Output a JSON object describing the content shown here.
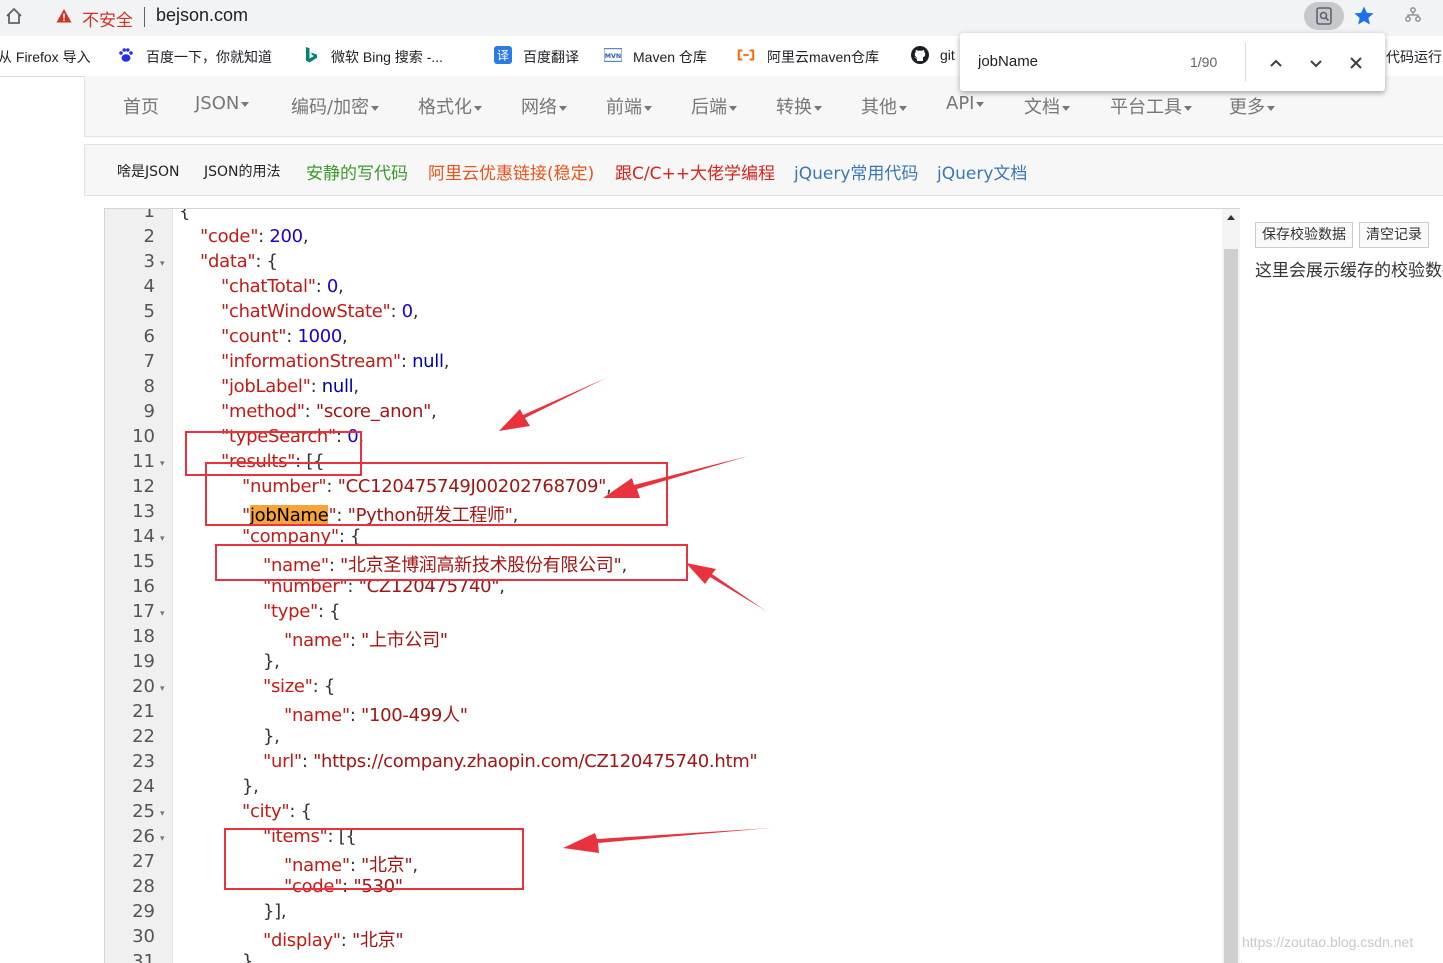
{
  "browser": {
    "security_label": "不安全",
    "url": "bejson.com",
    "icons": {
      "home": "home-icon",
      "warning": "warning-icon",
      "find": "find-icon",
      "star": "star-icon",
      "extension": "extension-icon"
    }
  },
  "bookmarks": [
    {
      "label": "从 Firefox 导入",
      "icon": ""
    },
    {
      "label": "百度一下，你就知道",
      "icon": "baidu-paw-icon"
    },
    {
      "label": "微软 Bing 搜索 -...",
      "icon": "bing-icon"
    },
    {
      "label": "百度翻译",
      "icon": "translate-icon"
    },
    {
      "label": "Maven 仓库",
      "icon": "maven-icon"
    },
    {
      "label": "阿里云maven仓库",
      "icon": "aliyun-icon"
    },
    {
      "label": "git",
      "icon": "github-icon"
    },
    {
      "label": "代码运行工",
      "icon": ""
    }
  ],
  "findbar": {
    "query": "jobName",
    "count": "1/90"
  },
  "site_nav": [
    {
      "label": "首页",
      "dropdown": false
    },
    {
      "label": "JSON",
      "dropdown": true
    },
    {
      "label": "编码/加密",
      "dropdown": true
    },
    {
      "label": "格式化",
      "dropdown": true
    },
    {
      "label": "网络",
      "dropdown": true
    },
    {
      "label": "前端",
      "dropdown": true
    },
    {
      "label": "后端",
      "dropdown": true
    },
    {
      "label": "转换",
      "dropdown": true
    },
    {
      "label": "其他",
      "dropdown": true
    },
    {
      "label": "API",
      "dropdown": true
    },
    {
      "label": "文档",
      "dropdown": true
    },
    {
      "label": "平台工具",
      "dropdown": true
    },
    {
      "label": "更多",
      "dropdown": true
    }
  ],
  "sub_nav": [
    {
      "label": "啥是JSON",
      "color": "#222222"
    },
    {
      "label": "JSON的用法",
      "color": "#222222"
    },
    {
      "label": "安静的写代码",
      "color": "#3c9a2c"
    },
    {
      "label": "阿里云优惠链接(稳定)",
      "color": "#e8541c"
    },
    {
      "label": "跟C/C++大佬学编程",
      "color": "#d9231c"
    },
    {
      "label": "jQuery常用代码",
      "color": "#3a78b5"
    },
    {
      "label": "jQuery文档",
      "color": "#3a78b5"
    }
  ],
  "editor": {
    "lines": [
      {
        "num": "1",
        "fold": false,
        "indent": 0,
        "parts": [
          [
            "p",
            "{"
          ]
        ]
      },
      {
        "num": "2",
        "fold": false,
        "indent": 1,
        "parts": [
          [
            "k",
            "\"code\""
          ],
          [
            "p",
            ": "
          ],
          [
            "n",
            "200"
          ],
          [
            "p",
            ","
          ]
        ]
      },
      {
        "num": "3",
        "fold": true,
        "indent": 1,
        "parts": [
          [
            "k",
            "\"data\""
          ],
          [
            "p",
            ": {"
          ]
        ]
      },
      {
        "num": "4",
        "fold": false,
        "indent": 2,
        "parts": [
          [
            "k",
            "\"chatTotal\""
          ],
          [
            "p",
            ": "
          ],
          [
            "n",
            "0"
          ],
          [
            "p",
            ","
          ]
        ]
      },
      {
        "num": "5",
        "fold": false,
        "indent": 2,
        "parts": [
          [
            "k",
            "\"chatWindowState\""
          ],
          [
            "p",
            ": "
          ],
          [
            "n",
            "0"
          ],
          [
            "p",
            ","
          ]
        ]
      },
      {
        "num": "6",
        "fold": false,
        "indent": 2,
        "parts": [
          [
            "k",
            "\"count\""
          ],
          [
            "p",
            ": "
          ],
          [
            "n",
            "1000"
          ],
          [
            "p",
            ","
          ]
        ]
      },
      {
        "num": "7",
        "fold": false,
        "indent": 2,
        "parts": [
          [
            "k",
            "\"informationStream\""
          ],
          [
            "p",
            ": "
          ],
          [
            "nul",
            "null"
          ],
          [
            "p",
            ","
          ]
        ]
      },
      {
        "num": "8",
        "fold": false,
        "indent": 2,
        "parts": [
          [
            "k",
            "\"jobLabel\""
          ],
          [
            "p",
            ": "
          ],
          [
            "nul",
            "null"
          ],
          [
            "p",
            ","
          ]
        ]
      },
      {
        "num": "9",
        "fold": false,
        "indent": 2,
        "parts": [
          [
            "k",
            "\"method\""
          ],
          [
            "p",
            ": "
          ],
          [
            "s",
            "\"score_anon\""
          ],
          [
            "p",
            ","
          ]
        ]
      },
      {
        "num": "10",
        "fold": false,
        "indent": 2,
        "parts": [
          [
            "k",
            "\"typeSearch\""
          ],
          [
            "p",
            ": "
          ],
          [
            "n",
            "0"
          ],
          [
            "p",
            ","
          ]
        ]
      },
      {
        "num": "11",
        "fold": true,
        "indent": 2,
        "parts": [
          [
            "k",
            "\"results\""
          ],
          [
            "p",
            ": [{"
          ]
        ]
      },
      {
        "num": "12",
        "fold": false,
        "indent": 3,
        "parts": [
          [
            "k",
            "\"number\""
          ],
          [
            "p",
            ": "
          ],
          [
            "s",
            "\"CC120475749J00202768709\""
          ],
          [
            "p",
            ","
          ]
        ]
      },
      {
        "num": "13",
        "fold": false,
        "indent": 3,
        "parts": [
          [
            "k",
            "\""
          ],
          [
            "hl",
            "jobName"
          ],
          [
            "k",
            "\""
          ],
          [
            "p",
            ": "
          ],
          [
            "s",
            "\"Python研发工程师\""
          ],
          [
            "p",
            ","
          ]
        ]
      },
      {
        "num": "14",
        "fold": true,
        "indent": 3,
        "parts": [
          [
            "k",
            "\"company\""
          ],
          [
            "p",
            ": {"
          ]
        ]
      },
      {
        "num": "15",
        "fold": false,
        "indent": 4,
        "parts": [
          [
            "k",
            "\"name\""
          ],
          [
            "p",
            ": "
          ],
          [
            "s",
            "\"北京圣博润高新技术股份有限公司\""
          ],
          [
            "p",
            ","
          ]
        ]
      },
      {
        "num": "16",
        "fold": false,
        "indent": 4,
        "parts": [
          [
            "k",
            "\"number\""
          ],
          [
            "p",
            ": "
          ],
          [
            "s",
            "\"CZ120475740\""
          ],
          [
            "p",
            ","
          ]
        ]
      },
      {
        "num": "17",
        "fold": true,
        "indent": 4,
        "parts": [
          [
            "k",
            "\"type\""
          ],
          [
            "p",
            ": {"
          ]
        ]
      },
      {
        "num": "18",
        "fold": false,
        "indent": 5,
        "parts": [
          [
            "k",
            "\"name\""
          ],
          [
            "p",
            ": "
          ],
          [
            "s",
            "\"上市公司\""
          ]
        ]
      },
      {
        "num": "19",
        "fold": false,
        "indent": 4,
        "parts": [
          [
            "p",
            "},"
          ]
        ]
      },
      {
        "num": "20",
        "fold": true,
        "indent": 4,
        "parts": [
          [
            "k",
            "\"size\""
          ],
          [
            "p",
            ": {"
          ]
        ]
      },
      {
        "num": "21",
        "fold": false,
        "indent": 5,
        "parts": [
          [
            "k",
            "\"name\""
          ],
          [
            "p",
            ": "
          ],
          [
            "s",
            "\"100-499人\""
          ]
        ]
      },
      {
        "num": "22",
        "fold": false,
        "indent": 4,
        "parts": [
          [
            "p",
            "},"
          ]
        ]
      },
      {
        "num": "23",
        "fold": false,
        "indent": 4,
        "parts": [
          [
            "k",
            "\"url\""
          ],
          [
            "p",
            ": "
          ],
          [
            "s",
            "\"https://company.zhaopin.com/CZ120475740.htm\""
          ]
        ]
      },
      {
        "num": "24",
        "fold": false,
        "indent": 3,
        "parts": [
          [
            "p",
            "},"
          ]
        ]
      },
      {
        "num": "25",
        "fold": true,
        "indent": 3,
        "parts": [
          [
            "k",
            "\"city\""
          ],
          [
            "p",
            ": {"
          ]
        ]
      },
      {
        "num": "26",
        "fold": true,
        "indent": 4,
        "parts": [
          [
            "k",
            "\"items\""
          ],
          [
            "p",
            ": [{"
          ]
        ]
      },
      {
        "num": "27",
        "fold": false,
        "indent": 5,
        "parts": [
          [
            "k",
            "\"name\""
          ],
          [
            "p",
            ": "
          ],
          [
            "s",
            "\"北京\""
          ],
          [
            "p",
            ","
          ]
        ]
      },
      {
        "num": "28",
        "fold": false,
        "indent": 5,
        "parts": [
          [
            "k",
            "\"code\""
          ],
          [
            "p",
            ": "
          ],
          [
            "s",
            "\"530\""
          ]
        ]
      },
      {
        "num": "29",
        "fold": false,
        "indent": 4,
        "parts": [
          [
            "p",
            "}],"
          ]
        ]
      },
      {
        "num": "30",
        "fold": false,
        "indent": 4,
        "parts": [
          [
            "k",
            "\"display\""
          ],
          [
            "p",
            ": "
          ],
          [
            "s",
            "\"北京\""
          ]
        ]
      },
      {
        "num": "31",
        "fold": false,
        "indent": 3,
        "parts": [
          [
            "p",
            "},"
          ]
        ]
      }
    ]
  },
  "right_panel": {
    "save_button": "保存校验数据",
    "clear_button": "清空记录",
    "note": "这里会展示缓存的校验数据"
  },
  "watermark": "https://zoutao.blog.csdn.net",
  "annotation_color": "#e8333f"
}
